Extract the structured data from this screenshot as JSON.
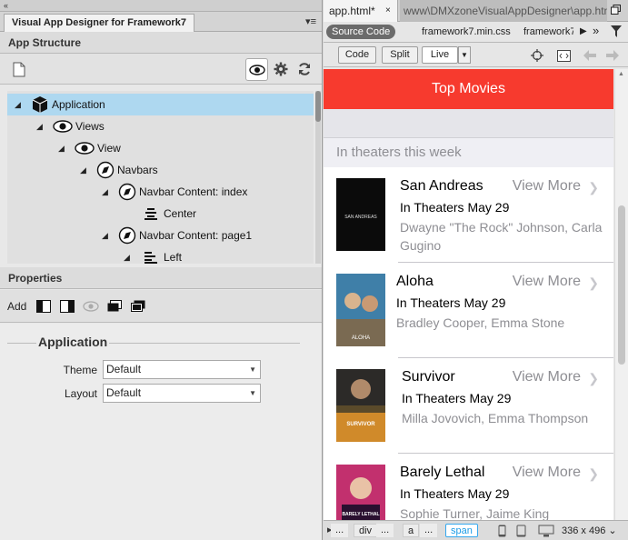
{
  "panel": {
    "strip_glyph": "«",
    "tab_title": "Visual App Designer for Framework7",
    "menu_glyph": "▾≡"
  },
  "structure": {
    "header": "App Structure",
    "tree": [
      {
        "label": "Application",
        "icon": "cube-icon",
        "selected": true
      },
      {
        "label": "Views",
        "icon": "eye-icon"
      },
      {
        "label": "View",
        "icon": "eye-icon"
      },
      {
        "label": "Navbars",
        "icon": "compass-icon"
      },
      {
        "label": "Navbar Content: index",
        "icon": "compass-icon"
      },
      {
        "label": "Center",
        "icon": "align-center-icon"
      },
      {
        "label": "Navbar Content: page1",
        "icon": "compass-icon"
      },
      {
        "label": "Left",
        "icon": "align-left-icon"
      }
    ]
  },
  "properties": {
    "header": "Properties",
    "add_label": "Add",
    "section_title": "Application",
    "fields": [
      {
        "label": "Theme",
        "value": "Default"
      },
      {
        "label": "Layout",
        "value": "Default"
      }
    ]
  },
  "document": {
    "active_tab": "app.html*",
    "close_glyph": "×",
    "path": "www\\DMXzoneVisualAppDesigner\\app.html",
    "source_code": "Source Code",
    "related_files": [
      "framework7.min.css",
      "framework7"
    ],
    "view_buttons": {
      "code": "Code",
      "split": "Split",
      "live": "Live"
    }
  },
  "app": {
    "navbar_title": "Top Movies",
    "list_header": "In theaters this week",
    "view_more": "View More",
    "movies": [
      {
        "title": "San Andreas",
        "date": "In Theaters May 29",
        "cast": "Dwayne \"The Rock\" Johnson, Carla Gugino",
        "poster_text": "SAN ANDREAS",
        "poster_bg": "#0b0b0b"
      },
      {
        "title": "Aloha",
        "date": "In Theaters May 29",
        "cast": "Bradley Cooper, Emma Stone",
        "poster_text": "ALOHA",
        "poster_bg": "#3f7fa8"
      },
      {
        "title": "Survivor",
        "date": "In Theaters May 29",
        "cast": "Milla Jovovich, Emma Thompson",
        "poster_text": "SURVIVOR",
        "poster_bg": "#5a4a2a"
      },
      {
        "title": "Barely Lethal",
        "date": "In Theaters May 29",
        "cast": "Sophie Turner, Jaime King",
        "poster_text": "BARELY LETHAL",
        "poster_bg": "#c2306e"
      }
    ]
  },
  "status": {
    "crumbs": [
      "...",
      "div",
      "...",
      "a",
      "...",
      "span"
    ],
    "selected_crumb": "span",
    "window_size": "336 x 496"
  },
  "colors": {
    "navbar": "#f73a2e",
    "selection": "#aed8f0",
    "selected_crumb": "#1a9be6"
  }
}
